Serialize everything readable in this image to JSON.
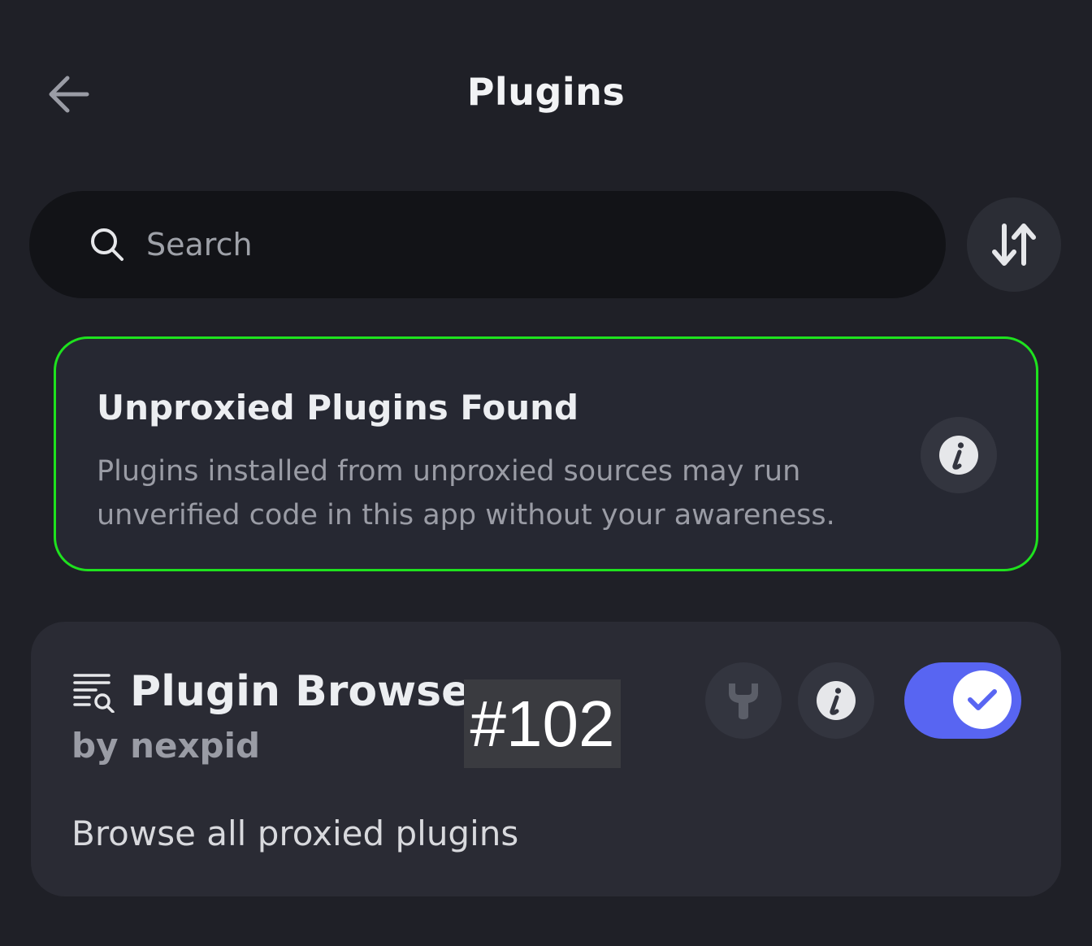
{
  "header": {
    "back_icon": "arrow-left-icon",
    "title": "Plugins"
  },
  "search": {
    "icon": "search-icon",
    "placeholder": "Search",
    "value": ""
  },
  "sort_button": {
    "icon": "sort-arrows-icon"
  },
  "warning": {
    "title": "Unproxied Plugins Found",
    "text": "Plugins installed from unproxied sources may run unverified code in this app without your awareness.",
    "info_icon": "info-icon",
    "border_color": "#1ee21e"
  },
  "plugin": {
    "icon": "list-search-icon",
    "name": "Plugin Browser",
    "author": "by nexpid",
    "description": "Browse all proxied plugins",
    "settings_icon": "wrench-icon",
    "info_icon": "info-icon",
    "enabled": true,
    "toggle_color": "#5865f2"
  },
  "badge": {
    "label": "#102"
  }
}
